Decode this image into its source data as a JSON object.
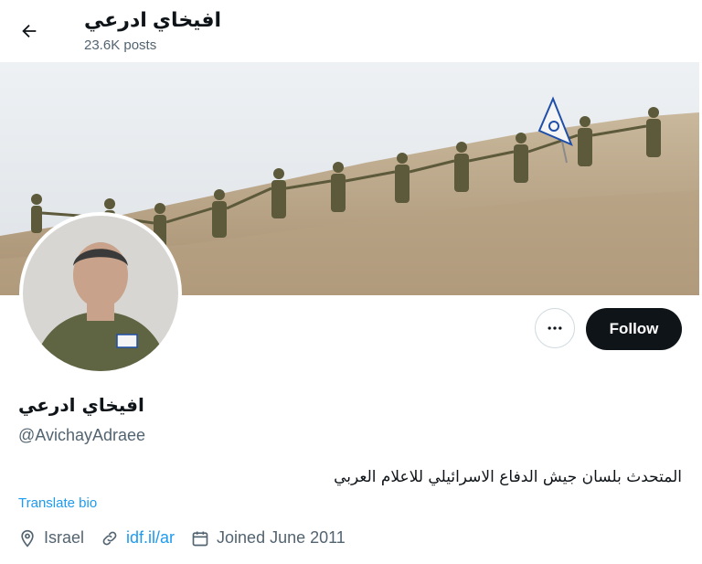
{
  "header": {
    "title": "افيخاي ادرعي",
    "posts": "23.6K posts"
  },
  "profile": {
    "display_name": "افيخاي ادرعي",
    "handle": "@AvichayAdraee",
    "bio": "المتحدث بلسان جيش الدفاع الاسرائيلي للاعلام العربي",
    "translate_label": "Translate bio",
    "location": "Israel",
    "website": "idf.il/ar",
    "joined": "Joined June 2011"
  },
  "actions": {
    "follow_label": "Follow",
    "more_label": "•••"
  },
  "colors": {
    "accent": "#1d9bf0",
    "follow_bg": "#0f1419",
    "secondary_text": "#536471"
  },
  "icons": [
    "back-arrow-icon",
    "more-icon",
    "location-icon",
    "link-icon",
    "calendar-icon"
  ]
}
